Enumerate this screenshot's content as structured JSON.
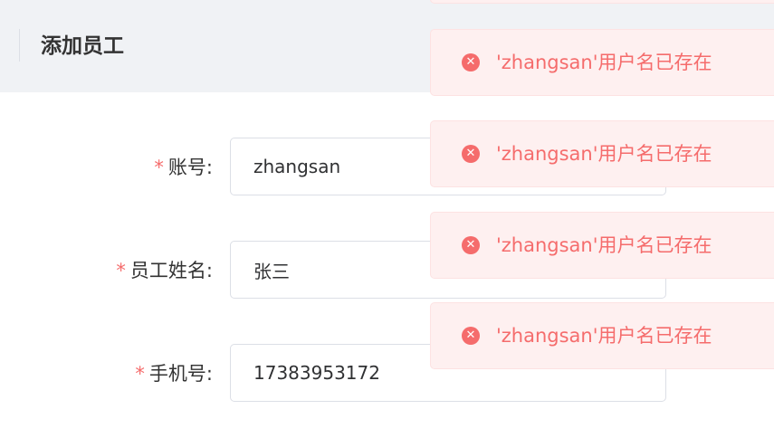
{
  "header": {
    "title": "添加员工"
  },
  "form": {
    "fields": [
      {
        "required_mark": "*",
        "label": "账号:",
        "value": "zhangsan"
      },
      {
        "required_mark": "*",
        "label": "员工姓名:",
        "value": "张三"
      },
      {
        "required_mark": "*",
        "label": "手机号:",
        "value": "17383953172"
      }
    ]
  },
  "toasts": [
    {
      "icon": "error-circle-icon",
      "text": "'zhangsan'用户名已存在"
    },
    {
      "icon": "error-circle-icon",
      "text": "'zhangsan'用户名已存在"
    },
    {
      "icon": "error-circle-icon",
      "text": "'zhangsan'用户名已存在"
    },
    {
      "icon": "error-circle-icon",
      "text": "'zhangsan'用户名已存在"
    }
  ],
  "colors": {
    "error": "#f56c6c",
    "toast_bg": "#fef0f0",
    "header_bg": "#f0f2f5"
  }
}
